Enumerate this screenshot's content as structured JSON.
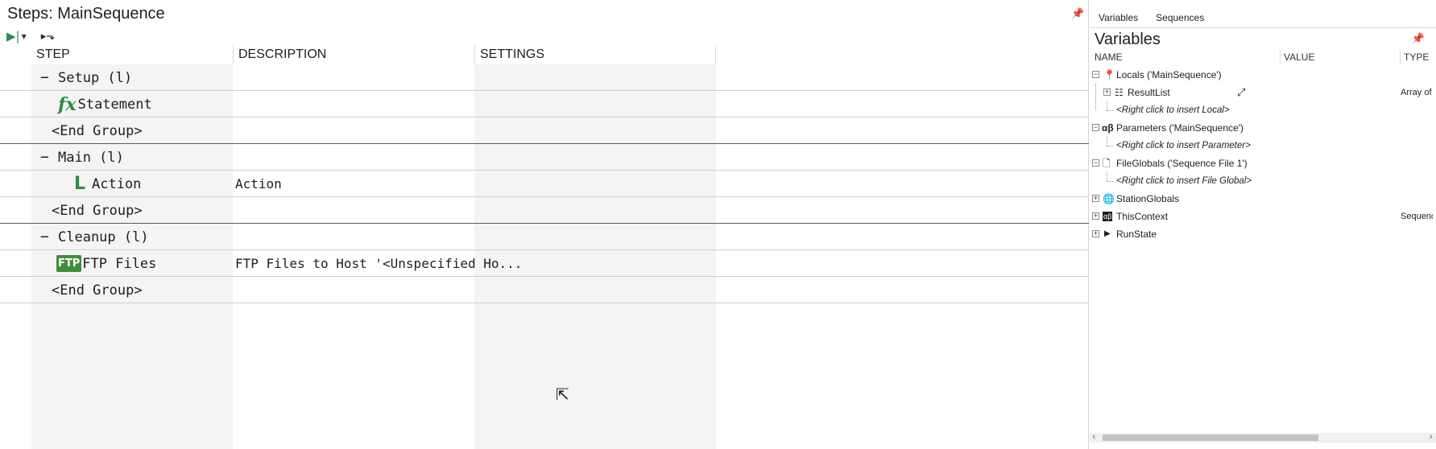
{
  "steps": {
    "title": "Steps: MainSequence",
    "columns": [
      "STEP",
      "DESCRIPTION",
      "SETTINGS"
    ],
    "toolbar": {
      "run_icon": "run-icon",
      "step_into_icon": "step-into-icon"
    },
    "rows": [
      {
        "kind": "group",
        "toggle": "−",
        "label": "Setup (l)",
        "desc": ""
      },
      {
        "kind": "step",
        "icon": "fx",
        "label": "Statement",
        "desc": ""
      },
      {
        "kind": "end",
        "label": "<End Group>",
        "desc": ""
      },
      {
        "kind": "group",
        "toggle": "−",
        "label": "Main (l)",
        "desc": ""
      },
      {
        "kind": "step",
        "icon": "L",
        "label": "Action",
        "desc": "Action"
      },
      {
        "kind": "end",
        "label": "<End Group>",
        "desc": ""
      },
      {
        "kind": "group",
        "toggle": "−",
        "label": "Cleanup (l)",
        "desc": ""
      },
      {
        "kind": "step",
        "icon": "FTP",
        "label": "FTP Files",
        "desc": "FTP Files to Host '<Unspecified Ho..."
      },
      {
        "kind": "end",
        "label": "<End Group>",
        "desc": ""
      }
    ]
  },
  "variables": {
    "tabs": [
      "Variables",
      "Sequences"
    ],
    "title": "Variables",
    "columns": {
      "name": "NAME",
      "value": "VALUE",
      "type": "TYPE"
    },
    "tree": {
      "locals": "Locals ('MainSequence')",
      "resultlist": "ResultList",
      "resultlist_type": "Array of R",
      "insert_local": "<Right click to insert Local>",
      "parameters": "Parameters ('MainSequence')",
      "insert_parameter": "<Right click to insert Parameter>",
      "fileglobals": "FileGlobals ('Sequence File 1')",
      "insert_fileglobal": "<Right click to insert File Global>",
      "stationglobals": "StationGlobals",
      "thiscontext": "ThisContext",
      "thiscontext_type": "Sequenc",
      "runstate": "RunState"
    },
    "params_icon_text": "αβ",
    "thiscontext_icon_text": "αβ"
  },
  "colors": {
    "accent_green": "#2e8b3a",
    "ftp_badge": "#3f8e3a",
    "column_shade": "#f4f4f4"
  }
}
